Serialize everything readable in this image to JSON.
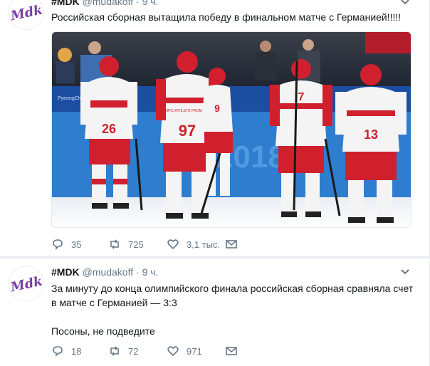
{
  "tweets": [
    {
      "name": "#MDK",
      "handle": "@mudakoff",
      "dot": "·",
      "time": "9 ч.",
      "text_lines": [
        "Российская сборная вытащила победу в финальном матче с Германией!!!!!"
      ],
      "media": {
        "description_icon": "hockey-team-photo",
        "banner_text": "PyeongChang 2018",
        "jersey_text": "OLYMPIC ATHLETE FROM RUSSIA",
        "players": [
          {
            "number": "26"
          },
          {
            "number": "97"
          },
          {
            "number": "9"
          },
          {
            "number": "7"
          },
          {
            "number": "13"
          }
        ]
      },
      "actions": {
        "reply_count": "35",
        "retweet_count": "725",
        "like_count": "3,1 тыс."
      }
    },
    {
      "name": "#MDK",
      "handle": "@mudakoff",
      "dot": "·",
      "time": "9 ч.",
      "text_lines": [
        "За минуту до конца олимпийского финала российская сборная сравняла счет",
        "в матче с Германией — 3:3",
        "",
        "Посоны, не подведите"
      ],
      "actions": {
        "reply_count": "18",
        "retweet_count": "72",
        "like_count": "971"
      }
    }
  ],
  "colors": {
    "link_gray": "#657786",
    "text": "#14171a",
    "avatar_logo": "#7b3fa0",
    "jersey_red": "#d0202e",
    "jersey_white": "#f4f4f4"
  }
}
